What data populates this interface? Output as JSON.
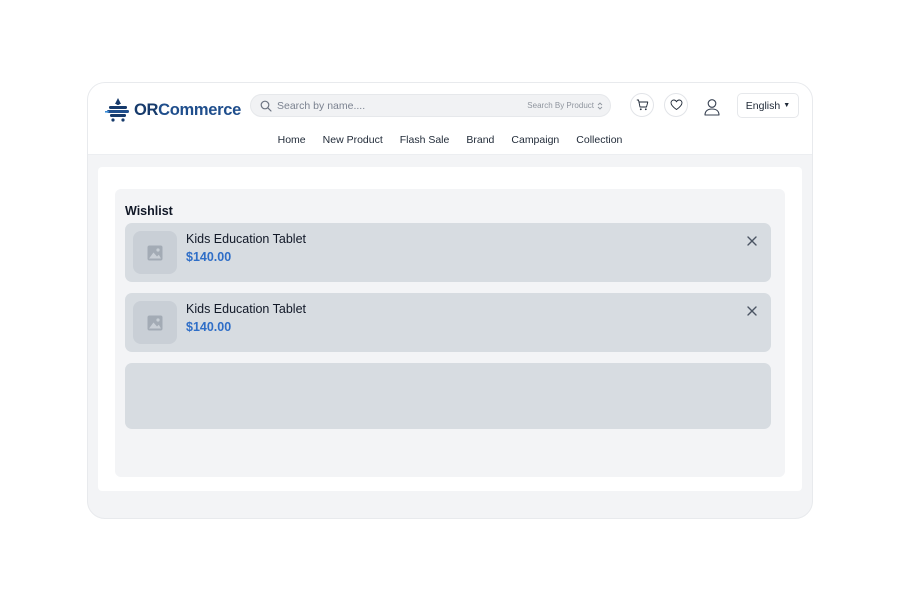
{
  "header": {
    "logo_text_highlight": "OR",
    "logo_text_rest": "Commerce",
    "search": {
      "placeholder": "Search by name....",
      "value": "",
      "scope_label": "Search By Product"
    },
    "language": "English"
  },
  "nav": {
    "items": [
      {
        "label": "Home"
      },
      {
        "label": "New Product"
      },
      {
        "label": "Flash Sale"
      },
      {
        "label": "Brand"
      },
      {
        "label": "Campaign"
      },
      {
        "label": "Collection"
      }
    ]
  },
  "wishlist": {
    "title": "Wishlist",
    "items": [
      {
        "name": "Kids Education Tablet",
        "price": "$140.00"
      },
      {
        "name": "Kids Education Tablet",
        "price": "$140.00"
      }
    ]
  },
  "colors": {
    "brand": "#163a6b",
    "price": "#2f6ec7",
    "card": "#d7dce1"
  },
  "icons": {
    "search": "search-icon",
    "cart": "cart-icon",
    "wishlist": "heart-icon",
    "account": "user-icon",
    "remove": "close-icon",
    "thumbnail": "image-placeholder-icon"
  }
}
